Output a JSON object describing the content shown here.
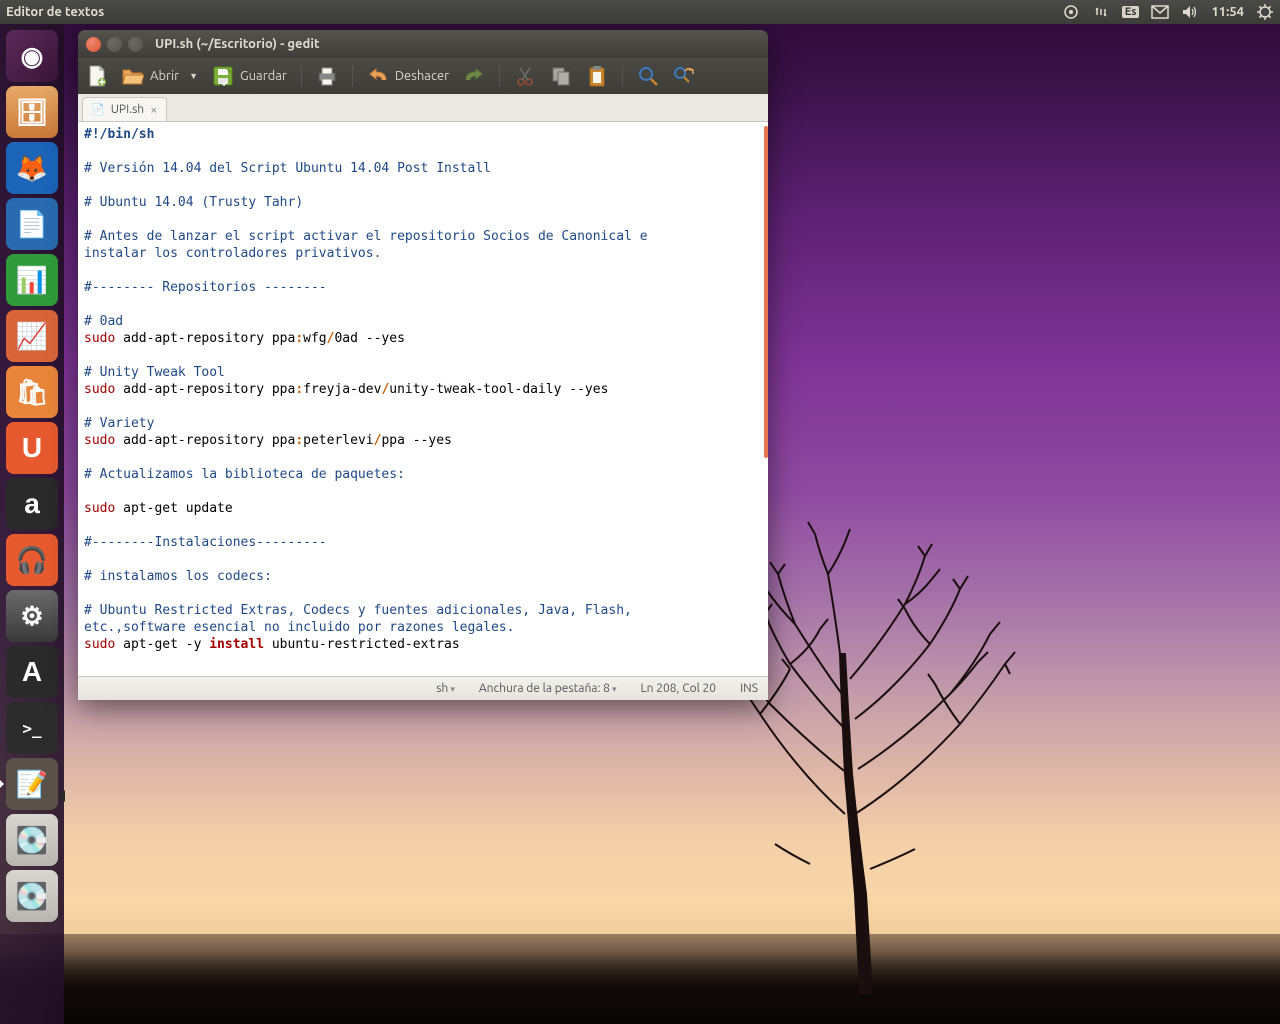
{
  "panel": {
    "app_title": "Editor de textos",
    "lang": "Es",
    "time": "11:54"
  },
  "launcher_items": [
    {
      "name": "dash",
      "bg": "linear-gradient(135deg,#5b2a59,#3a1638)",
      "glyph": "◉",
      "running": false
    },
    {
      "name": "files",
      "bg": "linear-gradient(180deg,#e8a968,#c97a3a)",
      "glyph": "🗄",
      "running": false
    },
    {
      "name": "firefox",
      "bg": "#1b64b8",
      "glyph": "🦊",
      "running": false
    },
    {
      "name": "writer",
      "bg": "#2a6bb0",
      "glyph": "📄",
      "running": false
    },
    {
      "name": "calc",
      "bg": "#2f9b3a",
      "glyph": "📊",
      "running": false
    },
    {
      "name": "impress",
      "bg": "#d9643a",
      "glyph": "📈",
      "running": false
    },
    {
      "name": "software-center",
      "bg": "#e8853a",
      "glyph": "🛍",
      "running": false
    },
    {
      "name": "ubuntu-one",
      "bg": "#e75a2f",
      "glyph": "U",
      "running": false
    },
    {
      "name": "amazon",
      "bg": "#2a2a2a",
      "glyph": "a",
      "running": false
    },
    {
      "name": "music",
      "bg": "#e75a2f",
      "glyph": "🎧",
      "running": false
    },
    {
      "name": "settings",
      "bg": "linear-gradient(180deg,#6a6a6a,#3a3a3a)",
      "glyph": "⚙",
      "running": false
    },
    {
      "name": "updater",
      "bg": "#2a2a2a",
      "glyph": "A",
      "running": false
    },
    {
      "name": "terminal",
      "bg": "#2c2c2c",
      "glyph": ">_",
      "running": false
    },
    {
      "name": "gedit",
      "bg": "#5a5248",
      "glyph": "📝",
      "running": true
    },
    {
      "name": "disk1",
      "bg": "linear-gradient(180deg,#d8d6d0,#b8b6b0)",
      "glyph": "💽",
      "running": false
    },
    {
      "name": "disk2",
      "bg": "linear-gradient(180deg,#d8d6d0,#b8b6b0)",
      "glyph": "💽",
      "running": false
    }
  ],
  "window": {
    "title": "UPI.sh (~/Escritorio) - gedit",
    "toolbar": {
      "open": "Abrir",
      "save": "Guardar",
      "undo": "Deshacer"
    },
    "tab": "UPI.sh",
    "status": {
      "lang": "sh",
      "tabwidth": "Anchura de la pestaña: 8",
      "pos": "Ln 208, Col 20",
      "ins": "INS"
    }
  },
  "code": {
    "shebang": "#!/bin/sh",
    "c1": "# Versión 14.04 del Script Ubuntu 14.04 Post Install",
    "c2": "# Ubuntu 14.04 (Trusty Tahr)",
    "c3a": "# Antes de lanzar el script activar el repositorio Socios de Canonical e",
    "c3b": "instalar los controladores privativos.",
    "c4": "#-------- Repositorios --------",
    "c5": "# 0ad",
    "s1a": "sudo",
    "s1b": " add-apt-repository ppa",
    "s1c": ":",
    "s1d": "wfg",
    "s1e": "/",
    "s1f": "0ad --yes",
    "c6": "# Unity Tweak Tool",
    "s2a": "sudo",
    "s2b": " add-apt-repository ppa",
    "s2c": ":",
    "s2d": "freyja-dev",
    "s2e": "/",
    "s2f": "unity-tweak-tool-daily --yes",
    "c7": "# Variety",
    "s3a": "sudo",
    "s3b": " add-apt-repository ppa",
    "s3c": ":",
    "s3d": "peterlevi",
    "s3e": "/",
    "s3f": "ppa --yes",
    "c8": "# Actualizamos la biblioteca de paquetes:",
    "s4a": "sudo",
    "s4b": " apt-get update",
    "c9": "#--------Instalaciones---------",
    "c10": "# instalamos los codecs:",
    "c11a": "# Ubuntu Restricted Extras, Codecs y fuentes adicionales, Java, Flash,",
    "c11b": "etc.,software esencial no incluido por razones legales.",
    "s5a": "sudo",
    "s5b": " apt-get -y ",
    "s5c": "install",
    "s5d": " ubuntu-restricted-extras"
  }
}
